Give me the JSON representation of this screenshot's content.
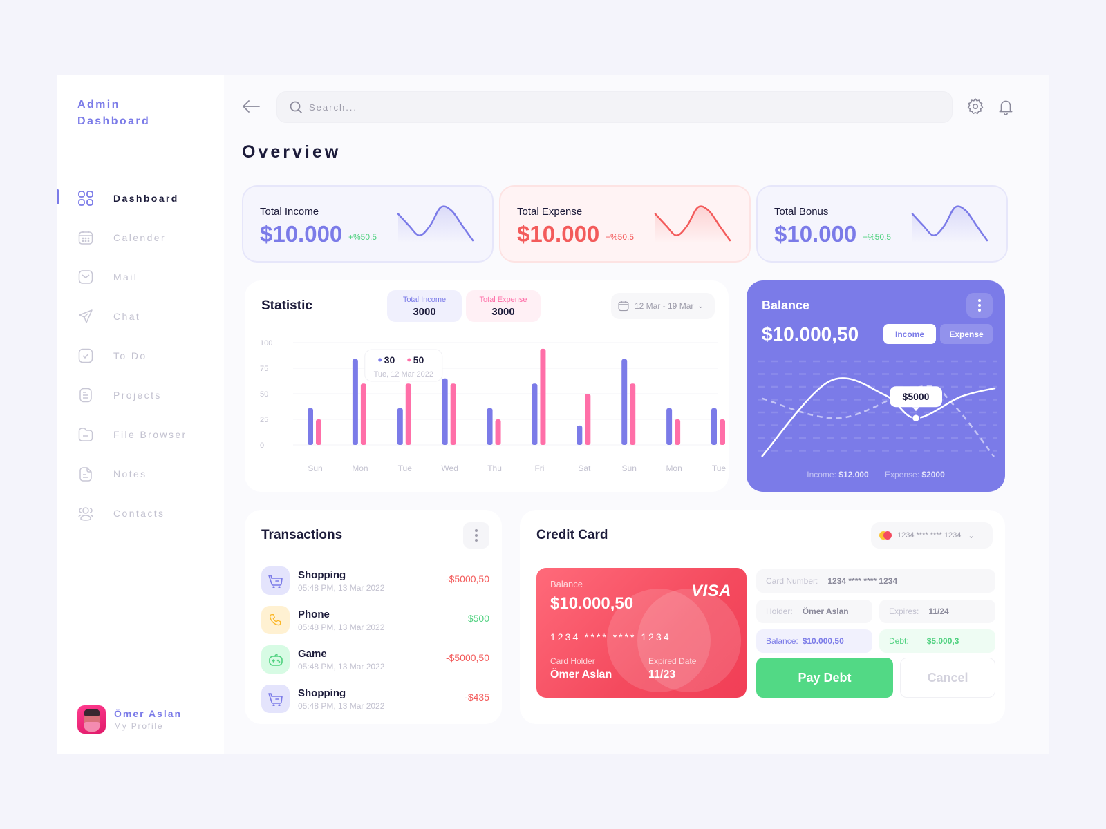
{
  "brand": {
    "line1": "Admin",
    "line2": "Dashboard"
  },
  "nav": [
    {
      "label": "Dashboard",
      "icon": "grid-icon",
      "active": true
    },
    {
      "label": "Calender",
      "icon": "calendar-icon"
    },
    {
      "label": "Mail",
      "icon": "mail-icon"
    },
    {
      "label": "Chat",
      "icon": "send-icon"
    },
    {
      "label": "To Do",
      "icon": "checkbox-icon"
    },
    {
      "label": "Projects",
      "icon": "document-icon"
    },
    {
      "label": "File Browser",
      "icon": "folder-icon"
    },
    {
      "label": "Notes",
      "icon": "note-icon"
    },
    {
      "label": "Contacts",
      "icon": "users-icon"
    }
  ],
  "profile": {
    "name": "Ömer Aslan",
    "subtitle": "My Profile"
  },
  "header": {
    "search_placeholder": "Search...",
    "title": "Overview"
  },
  "colors": {
    "accent": "#7b7be8",
    "expense": "#f35b5b",
    "pink": "#ff6fa8",
    "success": "#4fd17f",
    "text": "#1c1b3a"
  },
  "summary_cards": [
    {
      "title": "Total Income",
      "value": "$10.000",
      "change": "+%50,5",
      "theme": "blue",
      "trend": [
        0.2,
        0.55,
        0.85,
        0.55,
        0.0,
        0.1,
        0.55,
        1.0
      ]
    },
    {
      "title": "Total Expense",
      "value": "$10.000",
      "change": "+%50,5",
      "theme": "red",
      "trend": [
        0.2,
        0.55,
        0.85,
        0.55,
        0.0,
        0.1,
        0.55,
        1.0
      ]
    },
    {
      "title": "Total Bonus",
      "value": "$10.000",
      "change": "+%50,5",
      "theme": "blue",
      "trend": [
        0.2,
        0.55,
        0.85,
        0.55,
        0.0,
        0.1,
        0.55,
        1.0
      ]
    }
  ],
  "statistic": {
    "title": "Statistic",
    "income_pill": {
      "label": "Total Income",
      "value": "3000"
    },
    "expense_pill": {
      "label": "Total Expense",
      "value": "3000"
    },
    "date_range": "12 Mar - 19 Mar",
    "tooltip": {
      "income": "30",
      "expense": "50",
      "date": "Tue, 12 Mar 2022"
    }
  },
  "chart_data": {
    "type": "bar",
    "title": "Statistic",
    "categories": [
      "Sun",
      "Mon",
      "Tue",
      "Wed",
      "Thu",
      "Fri",
      "Sat",
      "Sun",
      "Mon",
      "Tue"
    ],
    "series": [
      {
        "name": "Total Income",
        "color": "#7b7be8",
        "values": [
          36,
          84,
          36,
          65,
          36,
          60,
          19,
          84,
          36,
          36
        ]
      },
      {
        "name": "Total Expense",
        "color": "#ff6fa8",
        "values": [
          25,
          60,
          60,
          60,
          25,
          94,
          50,
          60,
          25,
          25
        ]
      }
    ],
    "yticks": [
      0,
      25,
      50,
      75,
      100
    ],
    "ylim": [
      0,
      100
    ],
    "grid": true,
    "xlabel": "",
    "ylabel": ""
  },
  "balance": {
    "title": "Balance",
    "value": "$10.000,50",
    "toggle_income": "Income",
    "toggle_expense": "Expense",
    "tooltip": "$5000",
    "income_label": "Income:",
    "income_value": "$12.000",
    "expense_label": "Expense:",
    "expense_value": "$2000",
    "income_curve": [
      0.0,
      0.88,
      0.72,
      0.45,
      0.7,
      0.8
    ],
    "expense_curve": [
      0.68,
      0.45,
      0.82,
      0.6,
      0.0
    ]
  },
  "transactions": {
    "title": "Transactions",
    "items": [
      {
        "name": "Shopping",
        "date": "05:48 PM, 13 Mar 2022",
        "amount": "-$5000,50",
        "type": "debit",
        "icon": "cart-icon"
      },
      {
        "name": "Phone",
        "date": "05:48 PM, 13 Mar 2022",
        "amount": "$500",
        "type": "credit",
        "icon": "phone-icon"
      },
      {
        "name": "Game",
        "date": "05:48 PM, 13 Mar 2022",
        "amount": "-$5000,50",
        "type": "debit",
        "icon": "gamepad-icon"
      },
      {
        "name": "Shopping",
        "date": "05:48 PM, 13 Mar 2022",
        "amount": "-$435",
        "type": "debit",
        "icon": "cart-icon"
      }
    ]
  },
  "credit_card": {
    "title": "Credit Card",
    "selected_card": "1234 **** **** 1234",
    "card": {
      "balance_label": "Balance",
      "balance": "$10.000,50",
      "brand": "VISA",
      "number": "1234 **** **** 1234",
      "holder_label": "Card Holder",
      "holder": "Ömer Aslan",
      "expiry_label": "Expired Date",
      "expiry": "11/23"
    },
    "fields": {
      "number_label": "Card Number:",
      "number_value": "1234 **** **** 1234",
      "holder_label": "Holder:",
      "holder_value": "Ömer Aslan",
      "expires_label": "Expires:",
      "expires_value": "11/24",
      "balance_label": "Balance:",
      "balance_value": "$10.000,50",
      "debt_label": "Debt:",
      "debt_value": "$5.000,3"
    },
    "pay_button": "Pay Debt",
    "cancel_button": "Cancel"
  }
}
